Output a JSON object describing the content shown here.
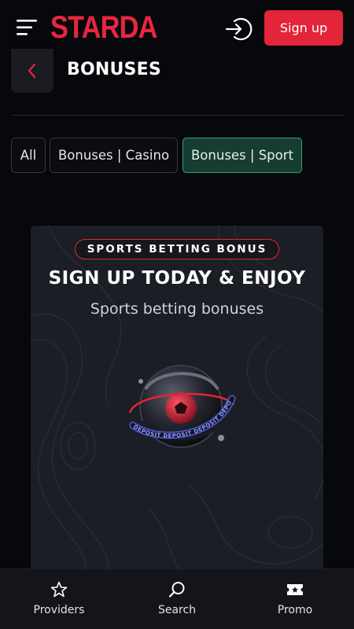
{
  "header": {
    "logo_text": "STARDA",
    "signup_label": "Sign up",
    "brand_color": "#e3243b",
    "menu_icon": "hamburger-menu-icon",
    "login_icon": "login-icon"
  },
  "page": {
    "title": "BONUSES",
    "back_icon": "chevron-left-icon"
  },
  "tabs": [
    {
      "label": "All",
      "active": false
    },
    {
      "label": "Bonuses | Casino",
      "active": false
    },
    {
      "label": "Bonuses | Sport",
      "active": true
    }
  ],
  "promo_card": {
    "badge": "SPORTS BETTING BONUS",
    "title": "SIGN UP TODAY & ENJOY",
    "subtitle": "Sports betting bonuses",
    "art_ring_text": "DEPOSIT DEPOSIT DEPOSIT DEPOSIT"
  },
  "bottom_nav": [
    {
      "label": "Providers",
      "icon": "star-icon"
    },
    {
      "label": "Search",
      "icon": "search-icon"
    },
    {
      "label": "Promo",
      "icon": "ticket-icon"
    }
  ],
  "colors": {
    "background": "#07080b",
    "accent_red": "#e3243b",
    "active_tab_bg": "#173d32",
    "active_tab_border": "#2aa376"
  }
}
